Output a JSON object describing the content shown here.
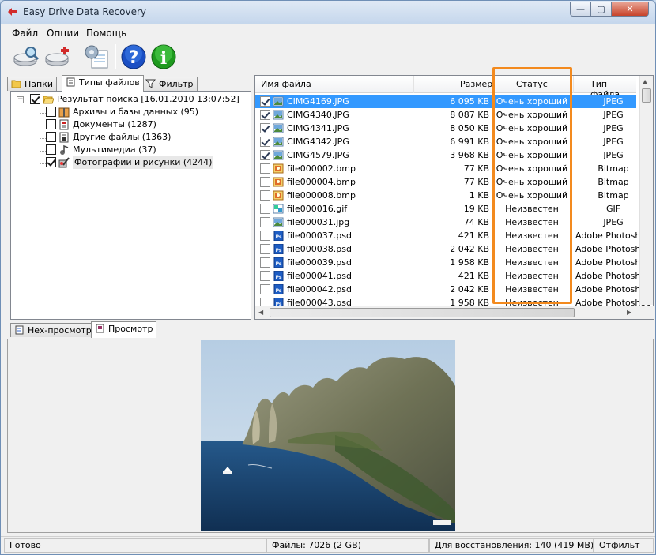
{
  "window": {
    "title": "Easy Drive Data Recovery",
    "min_symbol": "—",
    "max_symbol": "▢",
    "close_symbol": "✕"
  },
  "menu": [
    "Файл",
    "Опции",
    "Помощь"
  ],
  "toolbar": {
    "buttons": [
      {
        "name": "scan-drive-icon"
      },
      {
        "name": "recover-files-icon"
      },
      {
        "name": "settings-icon"
      },
      {
        "name": "help-icon",
        "glyph": "?"
      },
      {
        "name": "info-icon",
        "glyph": "i"
      }
    ]
  },
  "left_tabs": [
    "Папки",
    "Типы файлов",
    "Фильтр"
  ],
  "tree": {
    "root": "Результат поиска [16.01.2010 13:07:52]",
    "children": [
      {
        "label": "Архивы и базы данных (95)",
        "checked": false
      },
      {
        "label": "Документы (1287)",
        "checked": false
      },
      {
        "label": "Другие файлы (1363)",
        "checked": false
      },
      {
        "label": "Мультимедиа (37)",
        "checked": false
      },
      {
        "label": "Фотографии и рисунки (4244)",
        "checked": true
      }
    ]
  },
  "grid": {
    "headers": {
      "name": "Имя файла",
      "size": "Размер",
      "status": "Статус",
      "type": "Тип файла"
    },
    "rows": [
      {
        "name": "CIMG4169.JPG",
        "size": "6 095 KB",
        "status": "Очень хороший",
        "type": "JPEG",
        "checked": true,
        "icon": "jpg",
        "selected": true
      },
      {
        "name": "CIMG4340.JPG",
        "size": "8 087 KB",
        "status": "Очень хороший",
        "type": "JPEG",
        "checked": true,
        "icon": "jpg"
      },
      {
        "name": "CIMG4341.JPG",
        "size": "8 050 KB",
        "status": "Очень хороший",
        "type": "JPEG",
        "checked": true,
        "icon": "jpg"
      },
      {
        "name": "CIMG4342.JPG",
        "size": "6 991 KB",
        "status": "Очень хороший",
        "type": "JPEG",
        "checked": true,
        "icon": "jpg"
      },
      {
        "name": "CIMG4579.JPG",
        "size": "3 968 KB",
        "status": "Очень хороший",
        "type": "JPEG",
        "checked": true,
        "icon": "jpg"
      },
      {
        "name": "file000002.bmp",
        "size": "77 KB",
        "status": "Очень хороший",
        "type": "Bitmap",
        "checked": false,
        "icon": "bmp"
      },
      {
        "name": "file000004.bmp",
        "size": "77 KB",
        "status": "Очень хороший",
        "type": "Bitmap",
        "checked": false,
        "icon": "bmp"
      },
      {
        "name": "file000008.bmp",
        "size": "1 KB",
        "status": "Очень хороший",
        "type": "Bitmap",
        "checked": false,
        "icon": "bmp"
      },
      {
        "name": "file000016.gif",
        "size": "19 KB",
        "status": "Неизвестен",
        "type": "GIF",
        "checked": false,
        "icon": "gif"
      },
      {
        "name": "file000031.jpg",
        "size": "74 KB",
        "status": "Неизвестен",
        "type": "JPEG",
        "checked": false,
        "icon": "jpg"
      },
      {
        "name": "file000037.psd",
        "size": "421 KB",
        "status": "Неизвестен",
        "type": "Adobe Photoshop",
        "checked": false,
        "icon": "psd"
      },
      {
        "name": "file000038.psd",
        "size": "2 042 KB",
        "status": "Неизвестен",
        "type": "Adobe Photoshop",
        "checked": false,
        "icon": "psd"
      },
      {
        "name": "file000039.psd",
        "size": "1 958 KB",
        "status": "Неизвестен",
        "type": "Adobe Photoshop",
        "checked": false,
        "icon": "psd"
      },
      {
        "name": "file000041.psd",
        "size": "421 KB",
        "status": "Неизвестен",
        "type": "Adobe Photoshop",
        "checked": false,
        "icon": "psd"
      },
      {
        "name": "file000042.psd",
        "size": "2 042 KB",
        "status": "Неизвестен",
        "type": "Adobe Photoshop",
        "checked": false,
        "icon": "psd"
      },
      {
        "name": "file000043.psd",
        "size": "1 958 KB",
        "status": "Неизвестен",
        "type": "Adobe Photoshop",
        "checked": false,
        "icon": "psd"
      }
    ]
  },
  "bottom_tabs": [
    "Hex-просмотр",
    "Просмотр"
  ],
  "status": {
    "ready": "Готово",
    "files": "Файлы: 7026 (2 GB)",
    "to_restore": "Для восстановления: 140 (419 MB)",
    "filter": "Отфильт"
  },
  "colors": {
    "selection": "#3399ff",
    "highlight": "#f38a1e",
    "titlebar": "#c4d6ec"
  }
}
